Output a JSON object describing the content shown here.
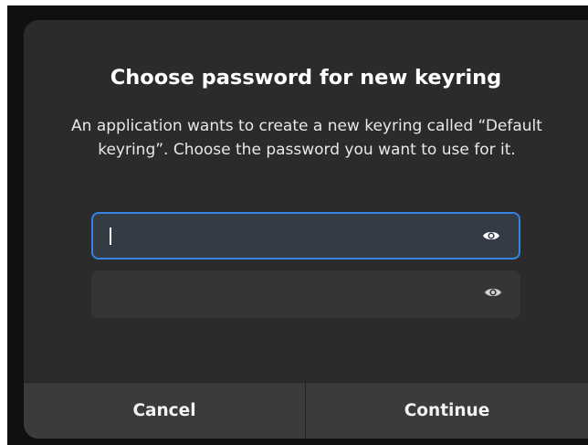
{
  "dialog": {
    "title": "Choose password for new keyring",
    "message": "An application wants to create a new keyring called “Default keyring”. Choose the password you want to use for it."
  },
  "fields": [
    {
      "name": "password",
      "value": "",
      "icon": "eye-icon",
      "focused": true
    },
    {
      "name": "confirm-password",
      "value": "",
      "icon": "eye-icon",
      "focused": false
    }
  ],
  "buttons": {
    "cancel": "Cancel",
    "continue": "Continue"
  },
  "colors": {
    "accent": "#3584e4",
    "dialog_bg": "#2b2b2b",
    "action_bar_bg": "#3b3b3b"
  }
}
